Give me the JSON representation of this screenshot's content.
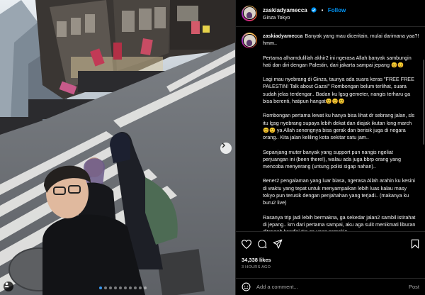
{
  "post": {
    "username": "zaskiadyamecca",
    "follow_label": "Follow",
    "separator": "•",
    "location": "Ginza Tokyo"
  },
  "caption": {
    "username": "zaskiadyamecca",
    "paragraphs": [
      "Banyak yang mau diceritain, mulai darimana yaa?! hmm..",
      "Pertama alhamdulillah akhir2 ini ngerasa Allah banyak sambungin hati dan diri dengan Palestin, dari jakarta sampai jepang 😊😊",
      "Lagi mau nyebrang di Ginza, taunya ada suara keras \"FREE FREE PALESTIN! Talk about Gaza!\" Rombongan belum terlihat, suara sudah jelas terdengar.. Badan ku lgsg gemeter, nangis terharu ga bisa berenti, hatipun hangat😊😊😊",
      "Rombongan pertama lewat ku hanya bisa lihat dr sebrang jalan, sls itu lgsg nyebrang supaya lebih dekat dan diajak ikutan long march 😊😊 ya Allah senengnya bisa gerak dan berisik juga di negara orang.. Kita jalan keliling kota sekitar satu jam..",
      "Sepanjang muter banyak yang support pun nangis ngeliat perjuangan ini (been there!), walau ada juga bbrp orang yang mencoba menyerang (untung polisi sigap nahan)..",
      "Bener2 pengalaman yang luar biasa, ngerasa Allah arahin ku kesini di waktu yang tepat untuk menyampaikan lebih luas kalau masy tokyo pun terusik dengan penjahahan yang terjadi.. (makanya ku buru2 live)",
      "Rasanya trip jadi lebih bermakna, ga sekedar jalan2 sambil istirahat di jepang.. krn dari pertama sampai, aku aga sulit menikmati liburan ditengah kondisi Ga za yang semakin"
    ]
  },
  "stats": {
    "likes": "34,338 likes",
    "time_ago": "3 HOURS AGO"
  },
  "comment_box": {
    "placeholder": "Add a comment...",
    "post_label": "Post"
  },
  "carousel": {
    "count": 10,
    "active_index": 0
  },
  "colors": {
    "background": "#000000",
    "follow_blue": "#0095f6",
    "verified_blue": "#0095f6",
    "muted_text": "#a8a8a8",
    "active_dot": "#3897f0"
  },
  "icons": [
    "verified-badge-icon",
    "heart-icon",
    "comment-icon",
    "share-icon",
    "bookmark-icon",
    "emoji-icon",
    "chevron-right-icon",
    "user-tag-icon"
  ]
}
